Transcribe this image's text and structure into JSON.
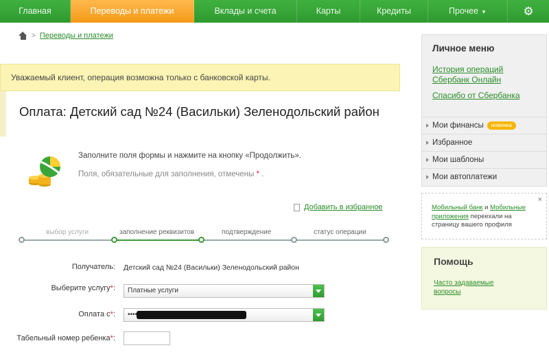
{
  "nav": {
    "items": [
      {
        "label": "Главная"
      },
      {
        "label": "Переводы и платежи"
      },
      {
        "label": "Вклады и счета"
      },
      {
        "label": "Карты"
      },
      {
        "label": "Кредиты"
      },
      {
        "label": "Прочее"
      }
    ],
    "gear_icon": "gear-icon",
    "active_color": "#f59a18",
    "brand_color": "#2f9a2f"
  },
  "breadcrumb": {
    "home_icon": "home-icon",
    "separator": ">",
    "current": "Переводы и платежи"
  },
  "warning": "Уважаемый клиент, операция возможна только с банковской карты.",
  "page": {
    "title": "Оплата: Детский сад №24 (Васильки) Зеленодольский район",
    "icon": "money-icon",
    "instruction": "Заполните поля формы и нажмите на кнопку «Продолжить».",
    "required_note": "Поля, обязательные для заполнения, отмечены",
    "required_star": "*",
    "required_dot": ".",
    "add_to_favorites": "Добавить в избранное"
  },
  "steps": [
    {
      "label": "выбор услуги"
    },
    {
      "label": "заполнение реквизитов",
      "active": true
    },
    {
      "label": "подтверждение"
    },
    {
      "label": "статус операции"
    }
  ],
  "form": {
    "recipient_label": "Получатель:",
    "recipient_value": "Детский сад №24 (Васильки) Зеленодольский район",
    "service_label": "Выберите услугу",
    "service_value": "Платные услуги",
    "payment_label": "Оплата с",
    "payment_value": "••••",
    "child_id_label": "Табельный номер ребенка",
    "star": "*",
    "colon": ":"
  },
  "sidebar": {
    "menu_title": "Личное меню",
    "links": [
      {
        "label": "История операций Сбербанк Онлайн"
      },
      {
        "label": "Спасибо от Сбербанка"
      }
    ],
    "items": [
      {
        "label": "Мои финансы",
        "badge": "новинка"
      },
      {
        "label": "Избранное"
      },
      {
        "label": "Мои шаблоны"
      },
      {
        "label": "Мои автоплатежи"
      }
    ],
    "promo": {
      "link1": "Мобильный банк",
      "and": "и",
      "link2": "Мобильные приложения",
      "rest": "переехали на страницу вашего профиля",
      "close": "×"
    },
    "help": {
      "title": "Помощь",
      "link": "Часто задаваемые вопросы"
    }
  }
}
